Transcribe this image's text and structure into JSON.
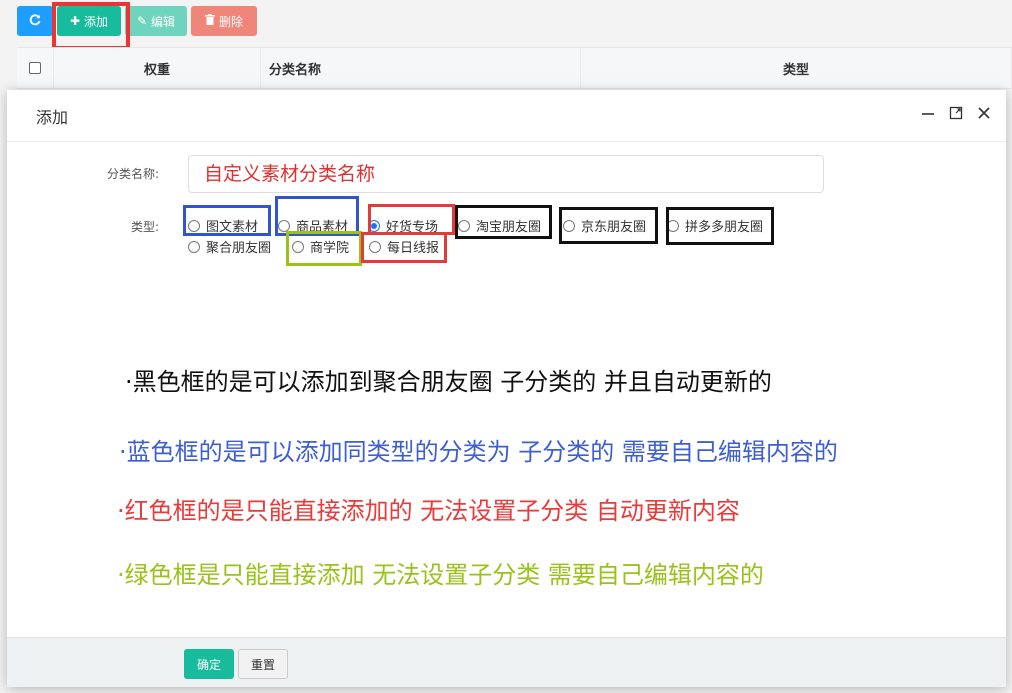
{
  "toolbar": {
    "refresh_icon": "refresh-icon",
    "add_label": "添加",
    "edit_label": "编辑",
    "delete_label": "删除"
  },
  "table": {
    "headers": [
      "权重",
      "分类名称",
      "类型"
    ]
  },
  "modal": {
    "title": "添加",
    "name_label": "分类名称:",
    "name_value": "自定义素材分类名称",
    "type_label": "类型:",
    "types": [
      {
        "label": "图文素材",
        "checked": false
      },
      {
        "label": "商品素材",
        "checked": false
      },
      {
        "label": "好货专场",
        "checked": true
      },
      {
        "label": "淘宝朋友圈",
        "checked": false
      },
      {
        "label": "京东朋友圈",
        "checked": false
      },
      {
        "label": "拼多多朋友圈",
        "checked": false
      },
      {
        "label": "聚合朋友圈",
        "checked": false
      },
      {
        "label": "商学院",
        "checked": false
      },
      {
        "label": "每日线报",
        "checked": false
      }
    ],
    "ok_label": "确定",
    "reset_label": "重置"
  },
  "notes": {
    "black": "·黑色框的是可以添加到聚合朋友圈 子分类的 并且自动更新的",
    "blue": "·蓝色框的是可以添加同类型的分类为 子分类的  需要自己编辑内容的",
    "red": "·红色框的是只能直接添加的  无法设置子分类 自动更新内容",
    "green": "·绿色框是只能直接添加   无法设置子分类  需要自己编辑内容的"
  },
  "colors": {
    "blue_box": "#3355cc",
    "red_box": "#e33a3a",
    "black_box": "#111111",
    "green_box": "#99c21a",
    "primary": "#18bc9c"
  }
}
